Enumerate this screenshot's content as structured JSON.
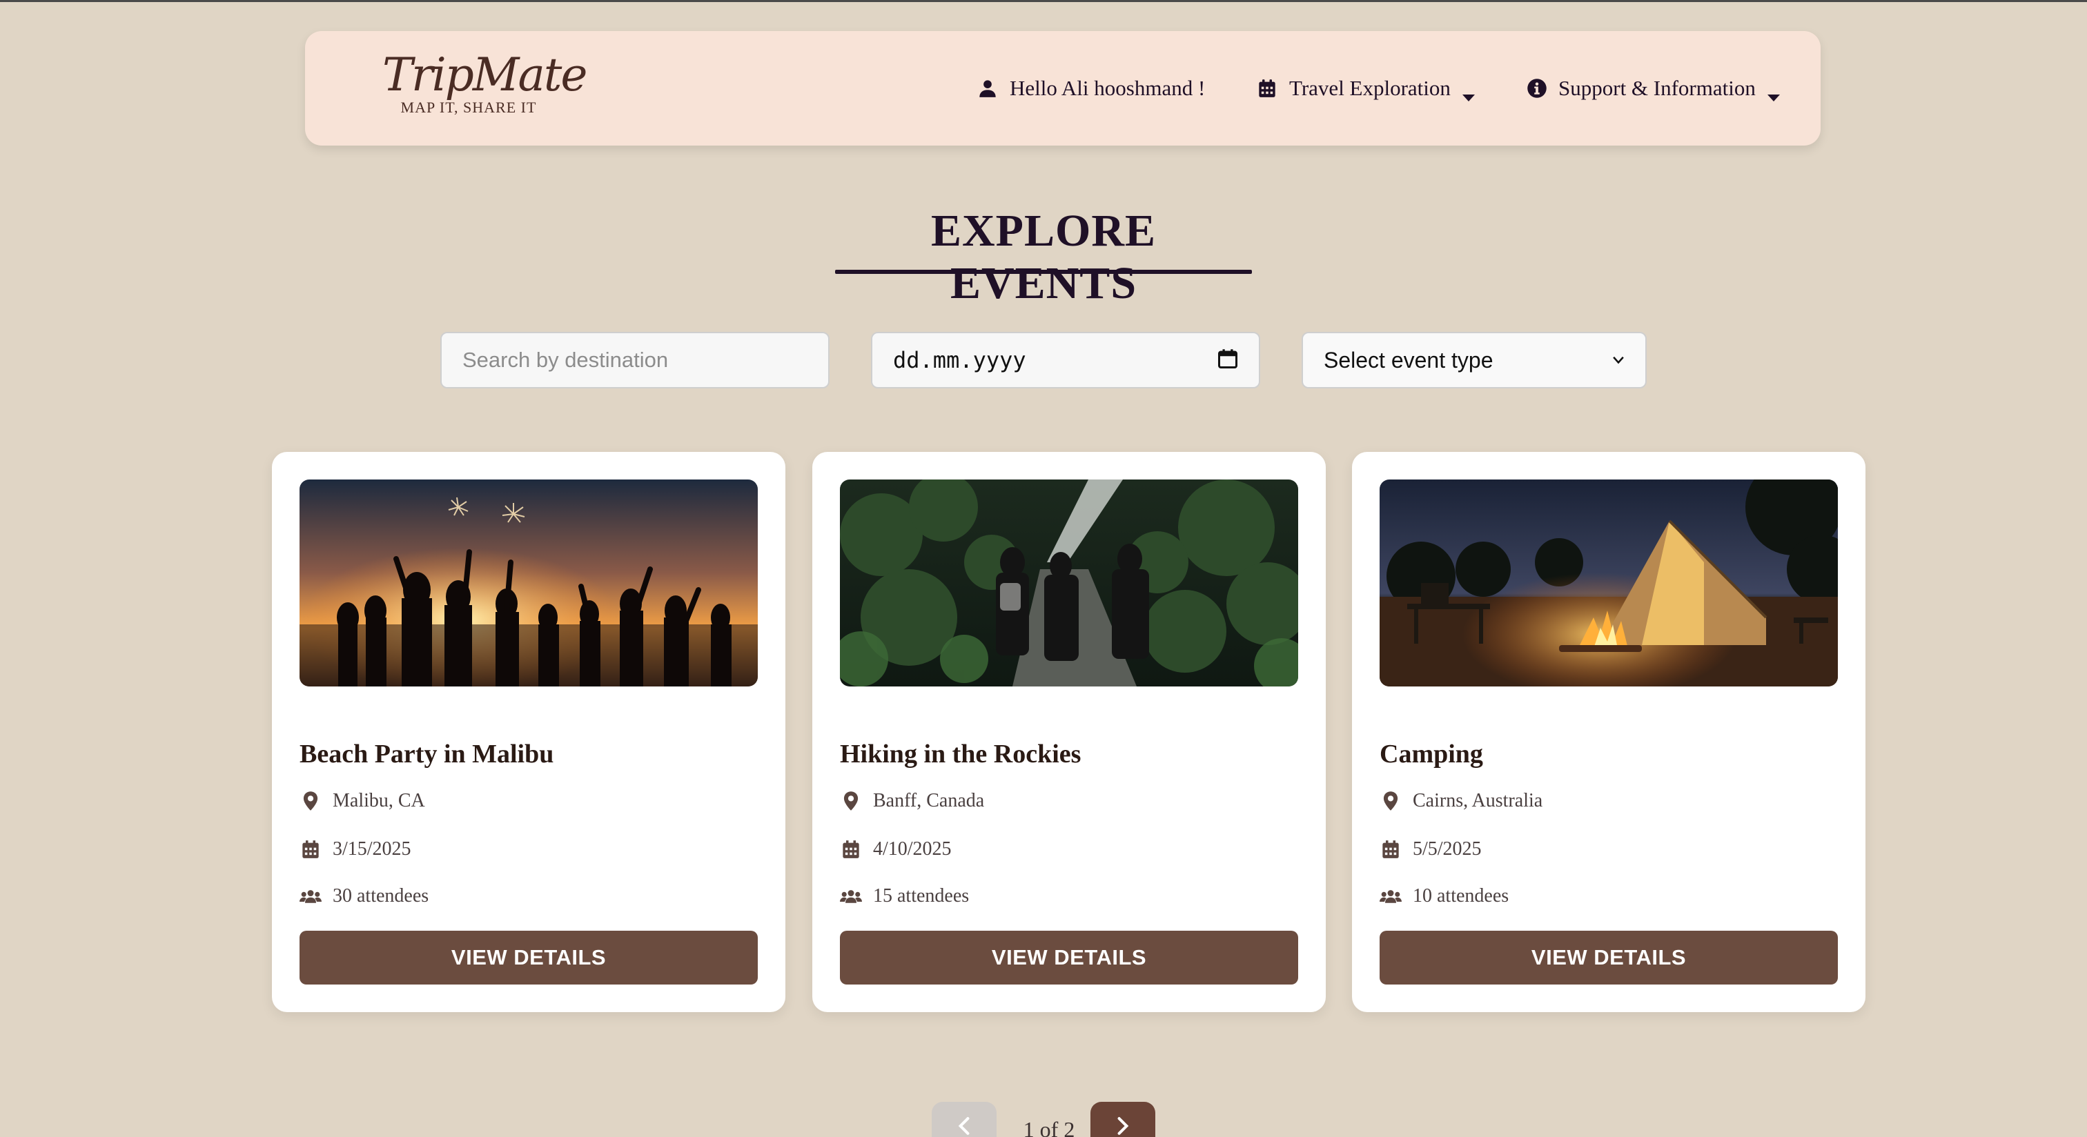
{
  "header": {
    "logo_main": "TripMate",
    "logo_tagline": "MAP IT, SHARE IT",
    "greeting": "Hello Ali hooshmand !",
    "menu_travel": "Travel Exploration",
    "menu_support": "Support & Information",
    "icons": [
      "user-icon",
      "calendar-icon",
      "info-icon",
      "caret-down-icon"
    ]
  },
  "page": {
    "title": "EXPLORE EVENTS"
  },
  "filters": {
    "search_placeholder": "Search by destination",
    "search_value": "",
    "date_placeholder": "dd.mm.yyyy",
    "event_type_selected": "Select event type"
  },
  "events": [
    {
      "title": "Beach Party in Malibu",
      "location": "Malibu, CA",
      "date": "3/15/2025",
      "attendees": "30 attendees",
      "button": "VIEW DETAILS",
      "image": "beach-party-sunset-photo"
    },
    {
      "title": "Hiking in the Rockies",
      "location": "Banff, Canada",
      "date": "4/10/2025",
      "attendees": "15 attendees",
      "button": "VIEW DETAILS",
      "image": "forest-hiking-photo"
    },
    {
      "title": "Camping",
      "location": "Cairns, Australia",
      "date": "5/5/2025",
      "attendees": "10 attendees",
      "button": "VIEW DETAILS",
      "image": "campfire-tent-photo"
    }
  ],
  "pagination": {
    "info": "1 of 2",
    "current": 1,
    "total": 2
  },
  "colors": {
    "background": "#e0d5c5",
    "navbar": "#f8e3d7",
    "accent_dark": "#1f1027",
    "button_brown": "#6b4c3f",
    "next_button": "#6b4437",
    "prev_button_disabled": "#cfcac6"
  }
}
